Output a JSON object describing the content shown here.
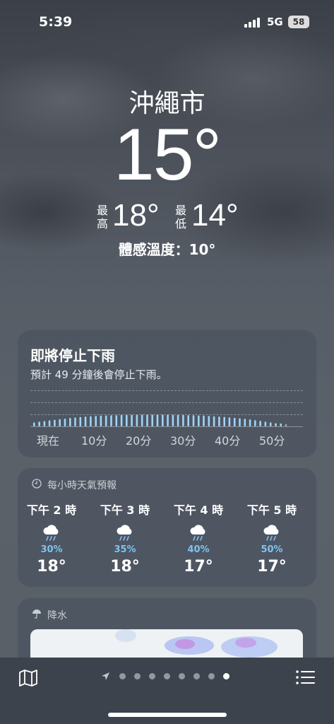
{
  "status_bar": {
    "time": "5:39",
    "network": "5G",
    "battery": "58"
  },
  "location": {
    "city": "沖繩市",
    "temperature": "15°",
    "high_label": "最高",
    "high": "18°",
    "low_label": "最低",
    "low": "14°",
    "feels_like": "體感溫度：10°"
  },
  "precip_card": {
    "title": "即將停止下雨",
    "subtitle": "預計 49 分鐘後會停止下雨。",
    "axis_labels": [
      "現在",
      "10分",
      "20分",
      "30分",
      "40分",
      "50分"
    ],
    "minutes_until_stop": 49,
    "intensity": [
      0.25,
      0.3,
      0.34,
      0.38,
      0.42,
      0.46,
      0.5,
      0.54,
      0.57,
      0.6,
      0.63,
      0.65,
      0.67,
      0.69,
      0.7,
      0.71,
      0.72,
      0.73,
      0.73,
      0.74,
      0.74,
      0.75,
      0.75,
      0.75,
      0.75,
      0.75,
      0.75,
      0.74,
      0.74,
      0.73,
      0.72,
      0.71,
      0.7,
      0.69,
      0.67,
      0.65,
      0.63,
      0.61,
      0.58,
      0.55,
      0.52,
      0.49,
      0.45,
      0.4,
      0.35,
      0.3,
      0.25,
      0.2,
      0.15,
      0.1
    ]
  },
  "hourly": {
    "header": "每小時天氣預報",
    "items": [
      {
        "time": "下午 2 時",
        "precip": "30%",
        "temp": "18°",
        "icon": "cloud-rain-icon"
      },
      {
        "time": "下午 3 時",
        "precip": "35%",
        "temp": "18°",
        "icon": "cloud-rain-icon"
      },
      {
        "time": "下午 4 時",
        "precip": "40%",
        "temp": "17°",
        "icon": "cloud-rain-icon"
      },
      {
        "time": "下午 5 時",
        "precip": "50%",
        "temp": "17°",
        "icon": "cloud-rain-icon"
      }
    ]
  },
  "precipitation_map": {
    "header": "降水",
    "icon": "umbrella-icon"
  },
  "bottom_bar": {
    "map_icon": "map-icon",
    "list_icon": "list-icon",
    "page_count": 8,
    "active_page": 8
  },
  "colors": {
    "precip_blue": "#7fc3f2",
    "bar_blue": "#9fd4f7"
  }
}
